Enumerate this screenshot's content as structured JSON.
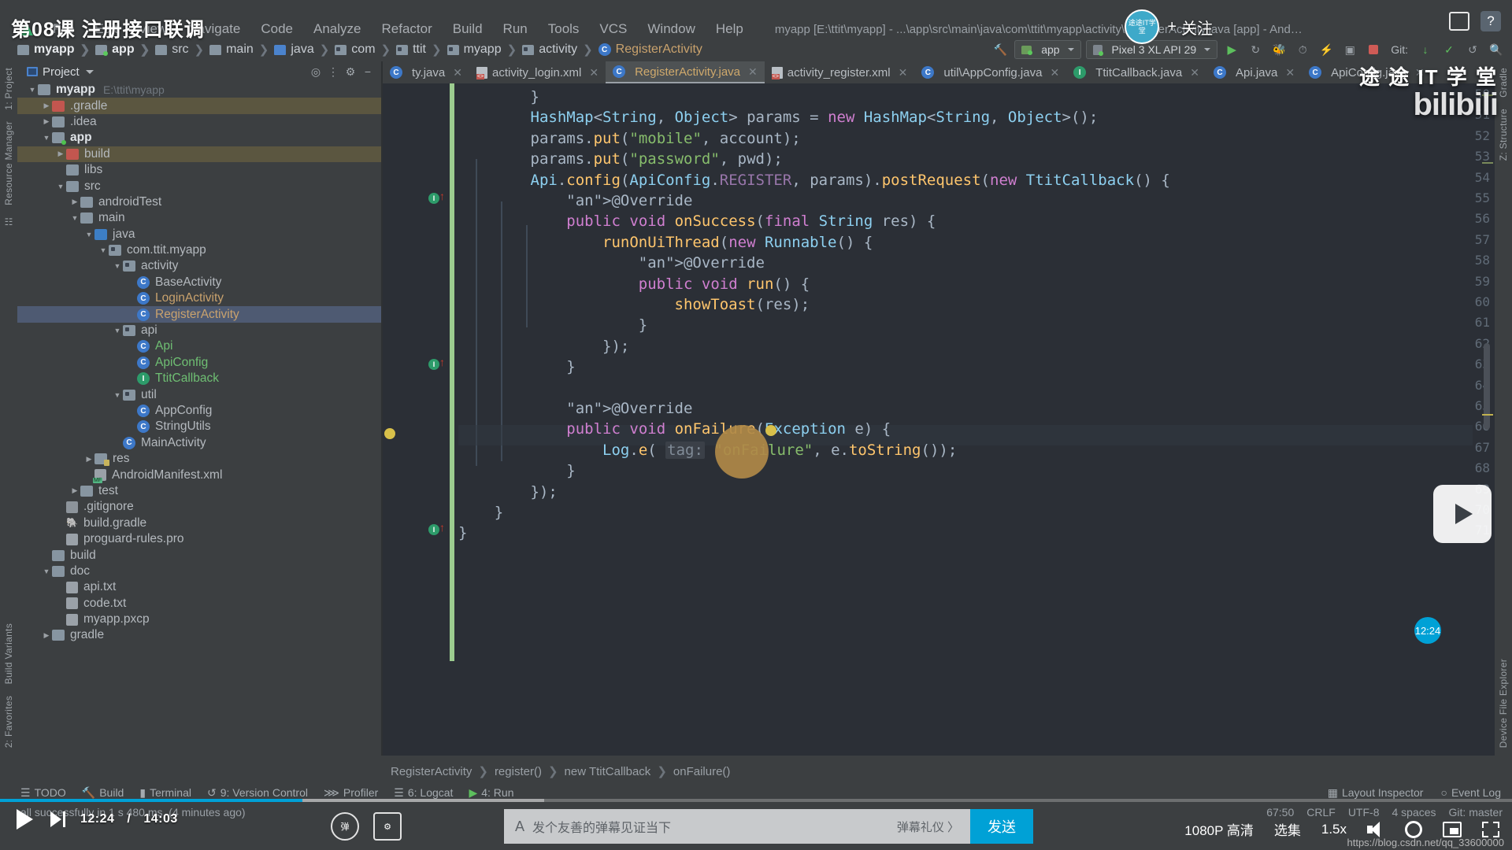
{
  "video": {
    "title": "第08课 注册接口联调",
    "follow_label": "关注",
    "up_avatar_label": "途途IT学堂",
    "brand_cn": "途 途 IT 学 堂",
    "brand_latin": "bilibili",
    "current_time": "12:24",
    "total_time": "14:03",
    "time_bubble": "12:24",
    "danmaku_placeholder": "发个友善的弹幕见证当下",
    "danmaku_settings": "弹幕礼仪 〉",
    "send_label": "发送",
    "quality": "1080P 高清",
    "episodes": "选集",
    "speed": "1.5x",
    "watermark": "https://blog.csdn.net/qq_33600000"
  },
  "ide": {
    "window_title": "myapp [E:\\ttit\\myapp] - ...\\app\\src\\main\\java\\com\\ttit\\myapp\\activity\\RegisterActivity.java [app] - Android Studio",
    "menu": [
      "File",
      "Edit",
      "View",
      "Navigate",
      "Code",
      "Analyze",
      "Refactor",
      "Build",
      "Run",
      "Tools",
      "VCS",
      "Window",
      "Help"
    ],
    "breadcrumb": [
      {
        "label": "myapp",
        "icon": "folder-icon",
        "bold": true
      },
      {
        "label": "app",
        "icon": "module-icon",
        "bold": true
      },
      {
        "label": "src",
        "icon": "folder-icon",
        "bold": false
      },
      {
        "label": "main",
        "icon": "folder-icon",
        "bold": false
      },
      {
        "label": "java",
        "icon": "source-folder-icon",
        "bold": false
      },
      {
        "label": "com",
        "icon": "package-icon",
        "bold": false
      },
      {
        "label": "ttit",
        "icon": "package-icon",
        "bold": false
      },
      {
        "label": "myapp",
        "icon": "package-icon",
        "bold": false
      },
      {
        "label": "activity",
        "icon": "package-icon",
        "bold": false
      },
      {
        "label": "RegisterActivity",
        "icon": "class-icon",
        "bold": false
      }
    ],
    "toolbar": {
      "run_config": "app",
      "device": "Pixel 3 XL API 29",
      "git_label": "Git:"
    },
    "project_panel": {
      "title": "Project",
      "tree": [
        {
          "indent": 0,
          "arrow": "d",
          "icon": "folder",
          "label": "myapp",
          "path": "E:\\ttit\\myapp",
          "bold": true,
          "state": ""
        },
        {
          "indent": 1,
          "arrow": "r",
          "icon": "folder-red",
          "label": ".gradle",
          "path": "",
          "bold": false,
          "state": "hl"
        },
        {
          "indent": 1,
          "arrow": "r",
          "icon": "folder",
          "label": ".idea",
          "path": "",
          "bold": false,
          "state": ""
        },
        {
          "indent": 1,
          "arrow": "d",
          "icon": "folder-module",
          "label": "app",
          "path": "",
          "bold": true,
          "state": ""
        },
        {
          "indent": 2,
          "arrow": "r",
          "icon": "folder-red",
          "label": "build",
          "path": "",
          "bold": false,
          "state": "hl"
        },
        {
          "indent": 2,
          "arrow": "",
          "icon": "folder",
          "label": "libs",
          "path": "",
          "bold": false,
          "state": ""
        },
        {
          "indent": 2,
          "arrow": "d",
          "icon": "folder",
          "label": "src",
          "path": "",
          "bold": false,
          "state": ""
        },
        {
          "indent": 3,
          "arrow": "r",
          "icon": "folder",
          "label": "androidTest",
          "path": "",
          "bold": false,
          "state": ""
        },
        {
          "indent": 3,
          "arrow": "d",
          "icon": "folder",
          "label": "main",
          "path": "",
          "bold": false,
          "state": ""
        },
        {
          "indent": 4,
          "arrow": "d",
          "icon": "folder-blue",
          "label": "java",
          "path": "",
          "bold": false,
          "state": ""
        },
        {
          "indent": 5,
          "arrow": "d",
          "icon": "package",
          "label": "com.ttit.myapp",
          "path": "",
          "bold": false,
          "state": ""
        },
        {
          "indent": 6,
          "arrow": "d",
          "icon": "package",
          "label": "activity",
          "path": "",
          "bold": false,
          "state": ""
        },
        {
          "indent": 7,
          "arrow": "",
          "icon": "class",
          "label": "BaseActivity",
          "path": "",
          "bold": false,
          "state": ""
        },
        {
          "indent": 7,
          "arrow": "",
          "icon": "class",
          "label": "LoginActivity",
          "path": "",
          "bold": false,
          "state": "",
          "color": "orange"
        },
        {
          "indent": 7,
          "arrow": "",
          "icon": "class",
          "label": "RegisterActivity",
          "path": "",
          "bold": false,
          "state": "sel",
          "color": "orange"
        },
        {
          "indent": 6,
          "arrow": "d",
          "icon": "package",
          "label": "api",
          "path": "",
          "bold": false,
          "state": ""
        },
        {
          "indent": 7,
          "arrow": "",
          "icon": "class",
          "label": "Api",
          "path": "",
          "bold": false,
          "state": "",
          "color": "green"
        },
        {
          "indent": 7,
          "arrow": "",
          "icon": "class",
          "label": "ApiConfig",
          "path": "",
          "bold": false,
          "state": "",
          "color": "green"
        },
        {
          "indent": 7,
          "arrow": "",
          "icon": "interface",
          "label": "TtitCallback",
          "path": "",
          "bold": false,
          "state": "",
          "color": "green"
        },
        {
          "indent": 6,
          "arrow": "d",
          "icon": "package",
          "label": "util",
          "path": "",
          "bold": false,
          "state": ""
        },
        {
          "indent": 7,
          "arrow": "",
          "icon": "class",
          "label": "AppConfig",
          "path": "",
          "bold": false,
          "state": ""
        },
        {
          "indent": 7,
          "arrow": "",
          "icon": "class",
          "label": "StringUtils",
          "path": "",
          "bold": false,
          "state": ""
        },
        {
          "indent": 6,
          "arrow": "",
          "icon": "class",
          "label": "MainActivity",
          "path": "",
          "bold": false,
          "state": ""
        },
        {
          "indent": 4,
          "arrow": "r",
          "icon": "folder-res",
          "label": "res",
          "path": "",
          "bold": false,
          "state": ""
        },
        {
          "indent": 4,
          "arrow": "",
          "icon": "manifest",
          "label": "AndroidManifest.xml",
          "path": "",
          "bold": false,
          "state": ""
        },
        {
          "indent": 3,
          "arrow": "r",
          "icon": "folder",
          "label": "test",
          "path": "",
          "bold": false,
          "state": ""
        },
        {
          "indent": 2,
          "arrow": "",
          "icon": "gitignore",
          "label": ".gitignore",
          "path": "",
          "bold": false,
          "state": ""
        },
        {
          "indent": 2,
          "arrow": "",
          "icon": "gradle",
          "label": "build.gradle",
          "path": "",
          "bold": false,
          "state": ""
        },
        {
          "indent": 2,
          "arrow": "",
          "icon": "file",
          "label": "proguard-rules.pro",
          "path": "",
          "bold": false,
          "state": ""
        },
        {
          "indent": 1,
          "arrow": "",
          "icon": "folder",
          "label": "build",
          "path": "",
          "bold": false,
          "state": ""
        },
        {
          "indent": 1,
          "arrow": "d",
          "icon": "folder",
          "label": "doc",
          "path": "",
          "bold": false,
          "state": ""
        },
        {
          "indent": 2,
          "arrow": "",
          "icon": "file",
          "label": "api.txt",
          "path": "",
          "bold": false,
          "state": ""
        },
        {
          "indent": 2,
          "arrow": "",
          "icon": "file",
          "label": "code.txt",
          "path": "",
          "bold": false,
          "state": ""
        },
        {
          "indent": 2,
          "arrow": "",
          "icon": "file",
          "label": "myapp.pxcp",
          "path": "",
          "bold": false,
          "state": ""
        },
        {
          "indent": 1,
          "arrow": "r",
          "icon": "folder",
          "label": "gradle",
          "path": "",
          "bold": false,
          "state": ""
        }
      ]
    },
    "left_strips": [
      "1: Project",
      "Resource Manager"
    ],
    "left_bottom_strips": [
      "Build Variants",
      "2: Favorites"
    ],
    "right_strips": [
      "Gradle",
      "Z: Structure"
    ],
    "right_bottom_strips": [
      "Device File Explorer"
    ],
    "tabs": [
      {
        "label": "ty.java",
        "icon": "class-icon",
        "active": false
      },
      {
        "label": "activity_login.xml",
        "icon": "xml-icon",
        "active": false
      },
      {
        "label": "RegisterActivity.java",
        "icon": "class-icon",
        "active": true
      },
      {
        "label": "activity_register.xml",
        "icon": "xml-icon",
        "active": false
      },
      {
        "label": "util\\AppConfig.java",
        "icon": "class-icon",
        "active": false
      },
      {
        "label": "TtitCallback.java",
        "icon": "interface-icon",
        "active": false
      },
      {
        "label": "Api.java",
        "icon": "class-icon",
        "active": false
      },
      {
        "label": "ApiConfig.java",
        "icon": "class-icon",
        "active": false
      }
    ],
    "code_lines": [
      {
        "no": 50,
        "text": "        }"
      },
      {
        "no": 51,
        "text": "        HashMap<String, Object> params = new HashMap<String, Object>();"
      },
      {
        "no": 52,
        "text": "        params.put(\"mobile\", account);"
      },
      {
        "no": 53,
        "text": "        params.put(\"password\", pwd);"
      },
      {
        "no": 54,
        "text": "        Api.config(ApiConfig.REGISTER, params).postRequest(new TtitCallback() {"
      },
      {
        "no": 55,
        "text": "            @Override"
      },
      {
        "no": 56,
        "text": "            public void onSuccess(final String res) {"
      },
      {
        "no": 57,
        "text": "                runOnUiThread(new Runnable() {"
      },
      {
        "no": 58,
        "text": "                    @Override"
      },
      {
        "no": 59,
        "text": "                    public void run() {"
      },
      {
        "no": 60,
        "text": "                        showToast(res);"
      },
      {
        "no": 61,
        "text": "                    }"
      },
      {
        "no": 62,
        "text": "                });"
      },
      {
        "no": 63,
        "text": "            }"
      },
      {
        "no": 64,
        "text": ""
      },
      {
        "no": 65,
        "text": "            @Override"
      },
      {
        "no": 66,
        "text": "            public void onFailure(Exception e) {"
      },
      {
        "no": 67,
        "text": "                Log.e( tag: \"onFailure\", e.toString());"
      },
      {
        "no": 68,
        "text": "            }"
      },
      {
        "no": 69,
        "text": "        });"
      },
      {
        "no": 70,
        "text": "    }"
      },
      {
        "no": 71,
        "text": "}"
      }
    ],
    "editor_breadcrumb": [
      "RegisterActivity",
      "register()",
      "new TtitCallback",
      "onFailure()"
    ],
    "bottom_tools": [
      {
        "label": "TODO",
        "icon": "todo-icon"
      },
      {
        "label": "Build",
        "icon": "build-icon"
      },
      {
        "label": "Terminal",
        "icon": "terminal-icon"
      },
      {
        "label": "9: Version Control",
        "icon": "vcs-icon"
      },
      {
        "label": "Profiler",
        "icon": "profiler-icon"
      },
      {
        "label": "6: Logcat",
        "icon": "logcat-icon"
      },
      {
        "label": "4: Run",
        "icon": "run-icon"
      }
    ],
    "bottom_tools_right": [
      {
        "label": "Layout Inspector",
        "icon": "layout-inspector-icon"
      },
      {
        "label": "Event Log",
        "icon": "event-log-icon"
      }
    ],
    "status_text": "all successfully in 1 s 480 ms. (4 minutes ago)",
    "status_right": [
      "67:50",
      "CRLF",
      "UTF-8",
      "4 spaces",
      "Git: master"
    ]
  }
}
